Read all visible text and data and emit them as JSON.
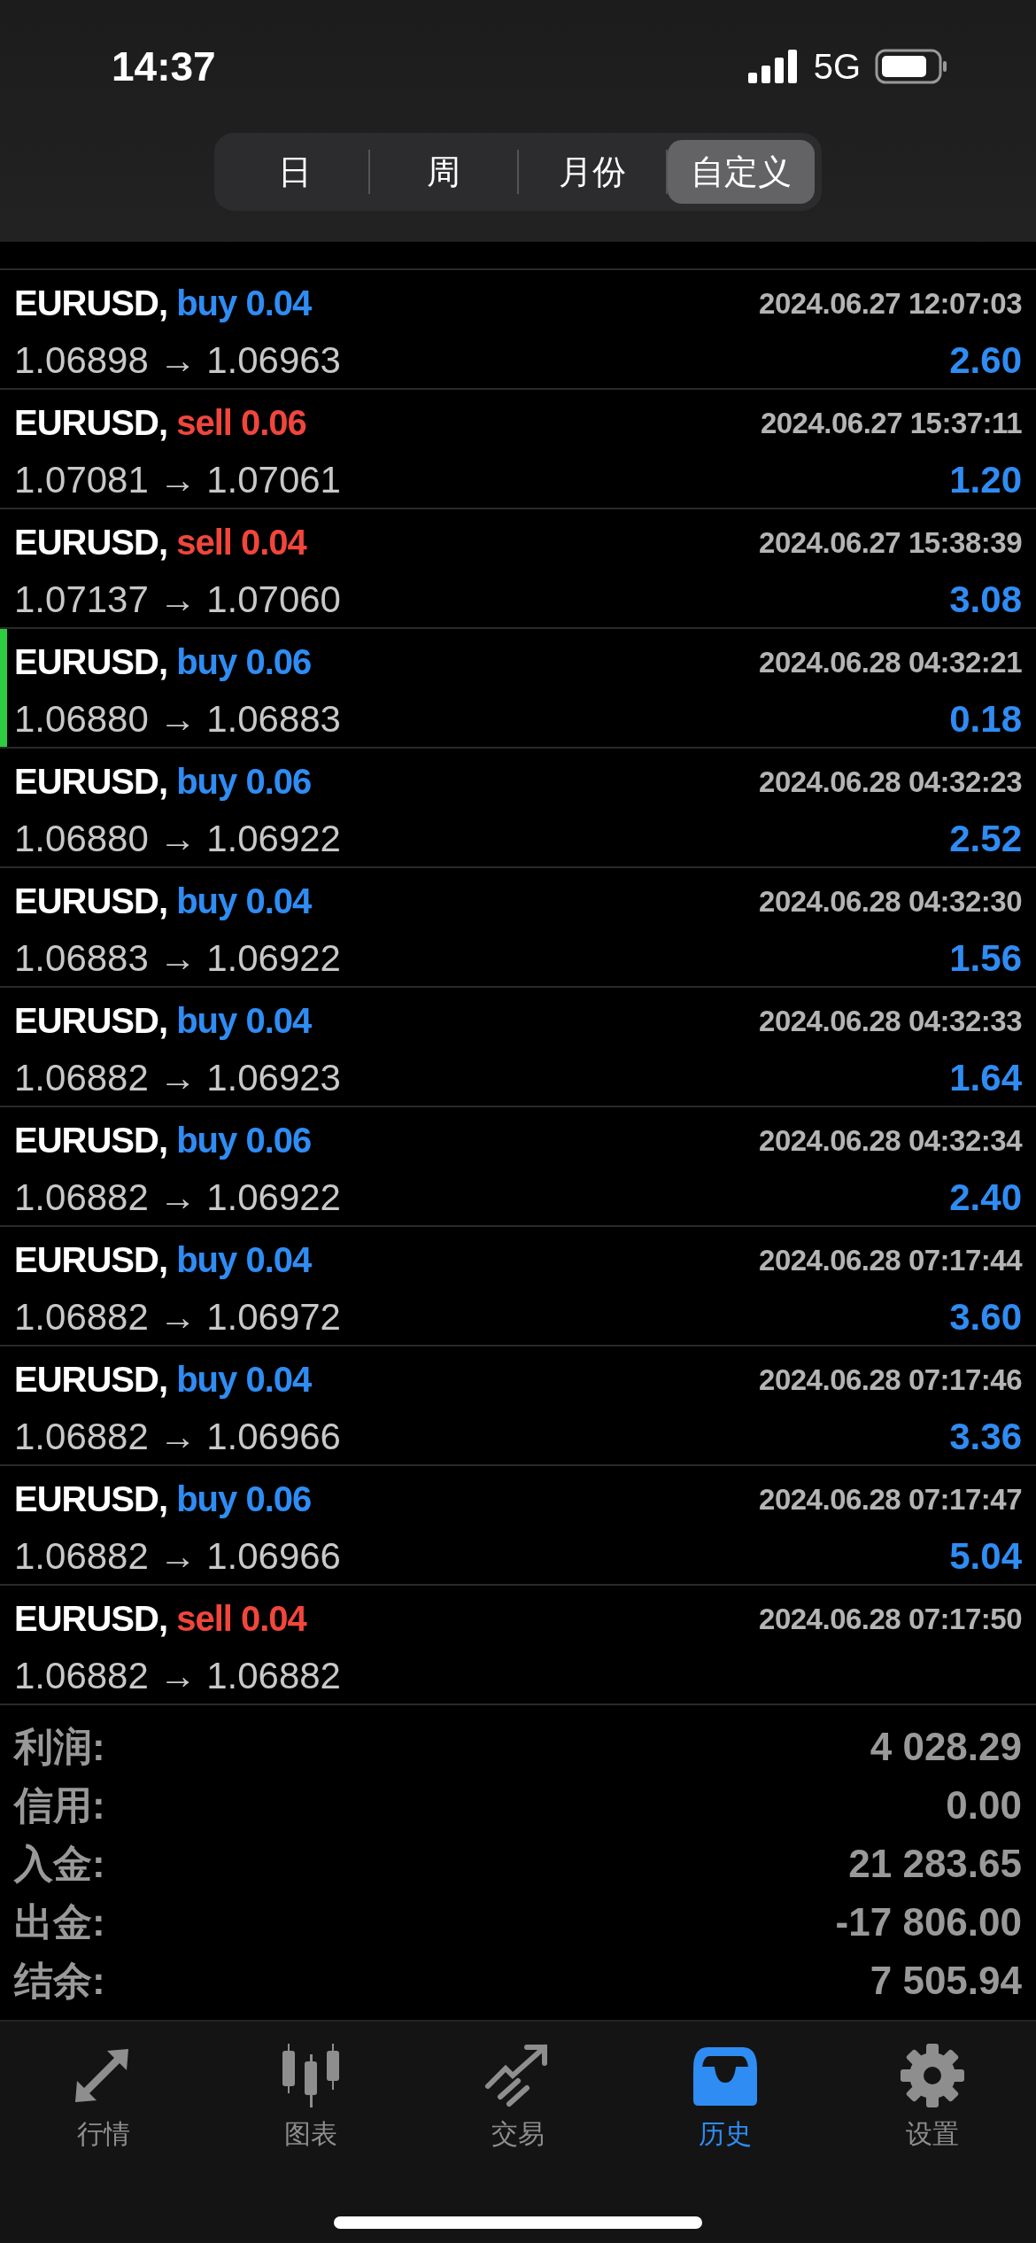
{
  "status_bar": {
    "time": "14:37",
    "network": "5G"
  },
  "period_tabs": [
    {
      "label": "日",
      "selected": false
    },
    {
      "label": "周",
      "selected": false
    },
    {
      "label": "月份",
      "selected": false
    },
    {
      "label": "自定义",
      "selected": true
    }
  ],
  "deals": [
    {
      "symbol": "EURUSD,",
      "kind": "buy",
      "order": "buy 0.04",
      "time": "2024.06.27 12:07:03",
      "prices": "1.06898 → 1.06963",
      "profit": "2.60",
      "highlighted": false
    },
    {
      "symbol": "EURUSD,",
      "kind": "sell",
      "order": "sell 0.06",
      "time": "2024.06.27 15:37:11",
      "prices": "1.07081 → 1.07061",
      "profit": "1.20",
      "highlighted": false
    },
    {
      "symbol": "EURUSD,",
      "kind": "sell",
      "order": "sell 0.04",
      "time": "2024.06.27 15:38:39",
      "prices": "1.07137 → 1.07060",
      "profit": "3.08",
      "highlighted": false
    },
    {
      "symbol": "EURUSD,",
      "kind": "buy",
      "order": "buy 0.06",
      "time": "2024.06.28 04:32:21",
      "prices": "1.06880 → 1.06883",
      "profit": "0.18",
      "highlighted": true
    },
    {
      "symbol": "EURUSD,",
      "kind": "buy",
      "order": "buy 0.06",
      "time": "2024.06.28 04:32:23",
      "prices": "1.06880 → 1.06922",
      "profit": "2.52",
      "highlighted": false
    },
    {
      "symbol": "EURUSD,",
      "kind": "buy",
      "order": "buy 0.04",
      "time": "2024.06.28 04:32:30",
      "prices": "1.06883 → 1.06922",
      "profit": "1.56",
      "highlighted": false
    },
    {
      "symbol": "EURUSD,",
      "kind": "buy",
      "order": "buy 0.04",
      "time": "2024.06.28 04:32:33",
      "prices": "1.06882 → 1.06923",
      "profit": "1.64",
      "highlighted": false
    },
    {
      "symbol": "EURUSD,",
      "kind": "buy",
      "order": "buy 0.06",
      "time": "2024.06.28 04:32:34",
      "prices": "1.06882 → 1.06922",
      "profit": "2.40",
      "highlighted": false
    },
    {
      "symbol": "EURUSD,",
      "kind": "buy",
      "order": "buy 0.04",
      "time": "2024.06.28 07:17:44",
      "prices": "1.06882 → 1.06972",
      "profit": "3.60",
      "highlighted": false
    },
    {
      "symbol": "EURUSD,",
      "kind": "buy",
      "order": "buy 0.04",
      "time": "2024.06.28 07:17:46",
      "prices": "1.06882 → 1.06966",
      "profit": "3.36",
      "highlighted": false
    },
    {
      "symbol": "EURUSD,",
      "kind": "buy",
      "order": "buy 0.06",
      "time": "2024.06.28 07:17:47",
      "prices": "1.06882 → 1.06966",
      "profit": "5.04",
      "highlighted": false
    },
    {
      "symbol": "EURUSD,",
      "kind": "sell",
      "order": "sell 0.04",
      "time": "2024.06.28 07:17:50",
      "prices": "1.06882 → 1.06882",
      "highlighted": false
    }
  ],
  "summary": [
    {
      "label": "利润:",
      "value": "4 028.29"
    },
    {
      "label": "信用:",
      "value": "0.00"
    },
    {
      "label": "入金:",
      "value": "21 283.65"
    },
    {
      "label": "出金:",
      "value": "-17 806.00"
    },
    {
      "label": "结余:",
      "value": "7 505.94"
    }
  ],
  "bottom_tabs": [
    {
      "kind": "quotes",
      "label": "行情",
      "selected": false
    },
    {
      "kind": "chart",
      "label": "图表",
      "selected": false
    },
    {
      "kind": "trade",
      "label": "交易",
      "selected": false
    },
    {
      "kind": "history",
      "label": "历史",
      "selected": true
    },
    {
      "kind": "settings",
      "label": "设置",
      "selected": false
    }
  ]
}
